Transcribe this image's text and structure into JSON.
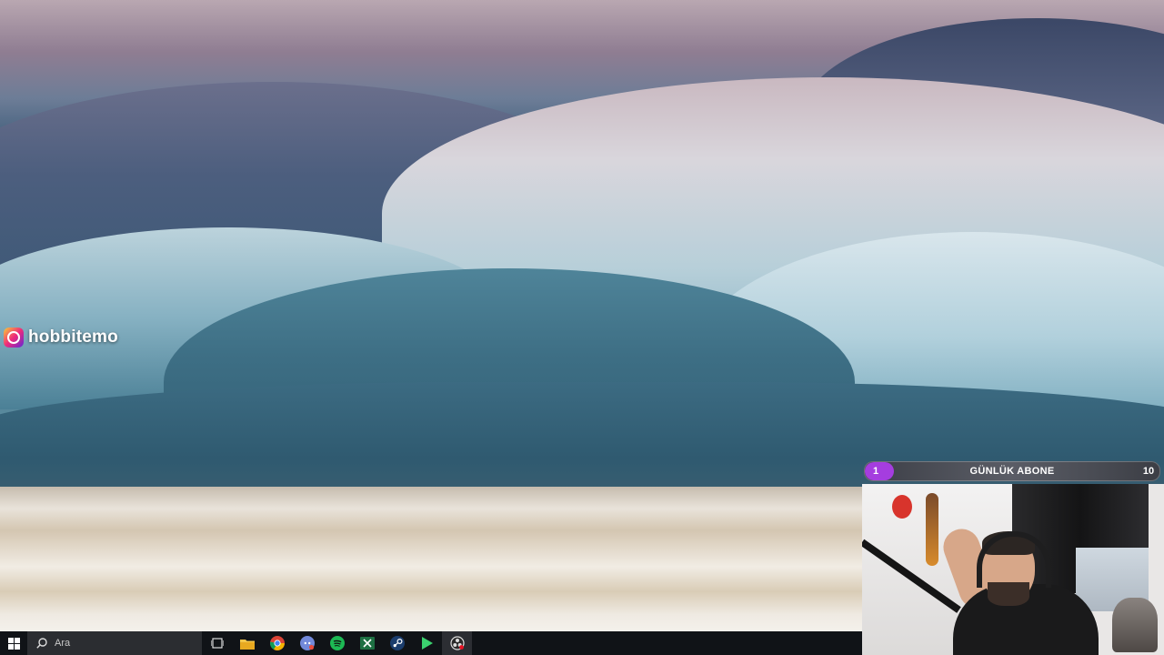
{
  "overlay": {
    "instagram_handle": "hobbitemo"
  },
  "subscriber_goal": {
    "current": "1",
    "title": "GÜNLÜK ABONE",
    "target": "10",
    "progress_fraction": 0.1,
    "fill_color": "#a53ddf"
  },
  "taskbar": {
    "search_placeholder": "Ara",
    "pinned_apps": [
      "task-view-icon",
      "file-explorer-icon",
      "chrome-icon",
      "discord-icon",
      "spotify-icon",
      "excel-icon",
      "steam-icon",
      "media-player-icon",
      "obs-icon"
    ]
  }
}
